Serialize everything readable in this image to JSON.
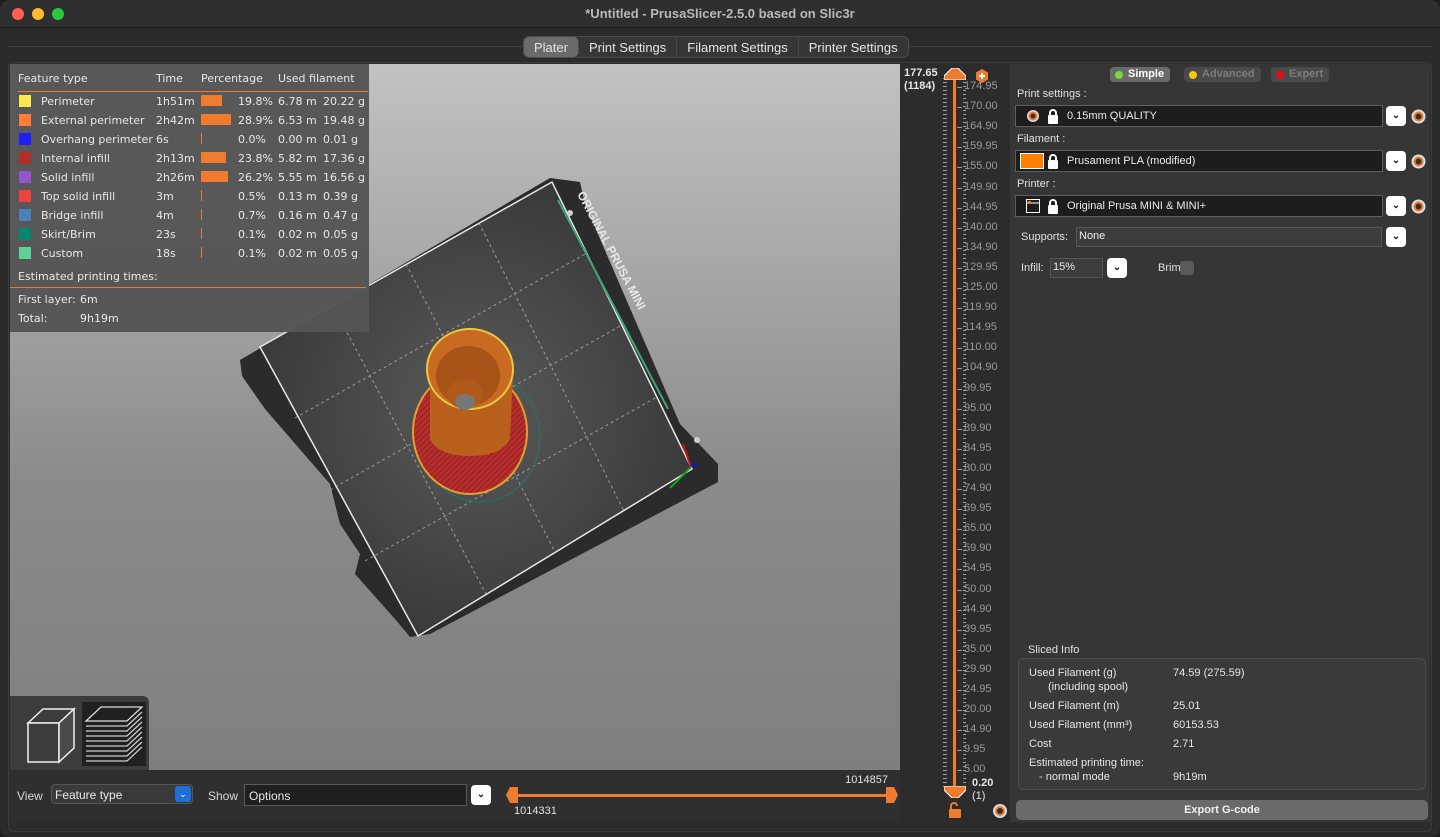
{
  "window": {
    "title": "*Untitled - PrusaSlicer-2.5.0 based on Slic3r"
  },
  "tabs": [
    {
      "label": "Plater",
      "active": true
    },
    {
      "label": "Print Settings",
      "active": false
    },
    {
      "label": "Filament Settings",
      "active": false
    },
    {
      "label": "Printer Settings",
      "active": false
    }
  ],
  "legend": {
    "headers": {
      "feature": "Feature type",
      "time": "Time",
      "percentage": "Percentage",
      "used": "Used filament"
    },
    "rows": [
      {
        "name": "Perimeter",
        "color": "#FFE64D",
        "time": "1h51m",
        "percent_value": 19.8,
        "percent": "19.8%",
        "length": "6.78 m",
        "weight": "20.22 g"
      },
      {
        "name": "External perimeter",
        "color": "#FF7D38",
        "time": "2h42m",
        "percent_value": 28.9,
        "percent": "28.9%",
        "length": "6.53 m",
        "weight": "19.48 g"
      },
      {
        "name": "Overhang perimeter",
        "color": "#1F1FFF",
        "time": "6s",
        "percent_value": 0.0,
        "percent": "0.0%",
        "length": "0.00 m",
        "weight": "0.01 g"
      },
      {
        "name": "Internal infill",
        "color": "#B03029",
        "time": "2h13m",
        "percent_value": 23.8,
        "percent": "23.8%",
        "length": "5.82 m",
        "weight": "17.36 g"
      },
      {
        "name": "Solid infill",
        "color": "#9654CC",
        "time": "2h26m",
        "percent_value": 26.2,
        "percent": "26.2%",
        "length": "5.55 m",
        "weight": "16.56 g"
      },
      {
        "name": "Top solid infill",
        "color": "#F04040",
        "time": "3m",
        "percent_value": 0.5,
        "percent": "0.5%",
        "length": "0.13 m",
        "weight": "0.39 g"
      },
      {
        "name": "Bridge infill",
        "color": "#4D80BA",
        "time": "4m",
        "percent_value": 0.7,
        "percent": "0.7%",
        "length": "0.16 m",
        "weight": "0.47 g"
      },
      {
        "name": "Skirt/Brim",
        "color": "#00876E",
        "time": "23s",
        "percent_value": 0.1,
        "percent": "0.1%",
        "length": "0.02 m",
        "weight": "0.05 g"
      },
      {
        "name": "Custom",
        "color": "#5ED194",
        "time": "18s",
        "percent_value": 0.1,
        "percent": "0.1%",
        "length": "0.02 m",
        "weight": "0.05 g"
      }
    ],
    "estimated_label": "Estimated printing times:",
    "first_layer_label": "First layer:",
    "first_layer_value": "6m",
    "total_label": "Total:",
    "total_value": "9h19m"
  },
  "bed": {
    "label": "ORIGINAL PRUSA MINI"
  },
  "bottom_bar": {
    "view_label": "View",
    "view_value": "Feature type",
    "show_label": "Show",
    "show_value": "Options",
    "moves_min": "1014331",
    "moves_max": "1014857"
  },
  "layer_slider": {
    "top_height": "177.65",
    "top_layer": "(1184)",
    "bottom_height": "0.20",
    "bottom_layer": "(1)",
    "ticks": [
      "174.95",
      "170.00",
      "164.90",
      "159.95",
      "155.00",
      "149.90",
      "144.95",
      "140.00",
      "134.90",
      "129.95",
      "125.00",
      "119.90",
      "114.95",
      "110.00",
      "104.90",
      "99.95",
      "95.00",
      "89.90",
      "84.95",
      "80.00",
      "74.90",
      "69.95",
      "65.00",
      "59.90",
      "54.95",
      "50.00",
      "44.90",
      "39.95",
      "35.00",
      "29.90",
      "24.95",
      "20.00",
      "14.90",
      "9.95",
      "5.00"
    ]
  },
  "sidebar": {
    "modes": [
      {
        "label": "Simple",
        "dot_color": "#7ad63a",
        "active": true
      },
      {
        "label": "Advanced",
        "dot_color": "#f2c90f",
        "active": false
      },
      {
        "label": "Expert",
        "dot_color": "#e01010",
        "active": false
      }
    ],
    "print_settings_label": "Print settings :",
    "print_settings_value": "0.15mm QUALITY",
    "filament_label": "Filament :",
    "filament_value": "Prusament PLA (modified)",
    "filament_color": "#FF8000",
    "printer_label": "Printer :",
    "printer_value": "Original Prusa MINI & MINI+",
    "supports_label": "Supports:",
    "supports_value": "None",
    "infill_label": "Infill:",
    "infill_value": "15%",
    "brim_label": "Brim:",
    "brim_checked": false
  },
  "sliced_info": {
    "title": "Sliced Info",
    "rows": [
      {
        "label": "Used Filament (g)",
        "sub": "(including spool)",
        "value": "74.59 (275.59)"
      },
      {
        "label": "Used Filament (m)",
        "value": "25.01"
      },
      {
        "label": "Used Filament (mm³)",
        "value": "60153.53"
      },
      {
        "label": "Cost",
        "value": "2.71"
      },
      {
        "label": "Estimated printing time:",
        "sub": "- normal mode",
        "value": "9h19m"
      }
    ],
    "export_label": "Export G-code"
  }
}
